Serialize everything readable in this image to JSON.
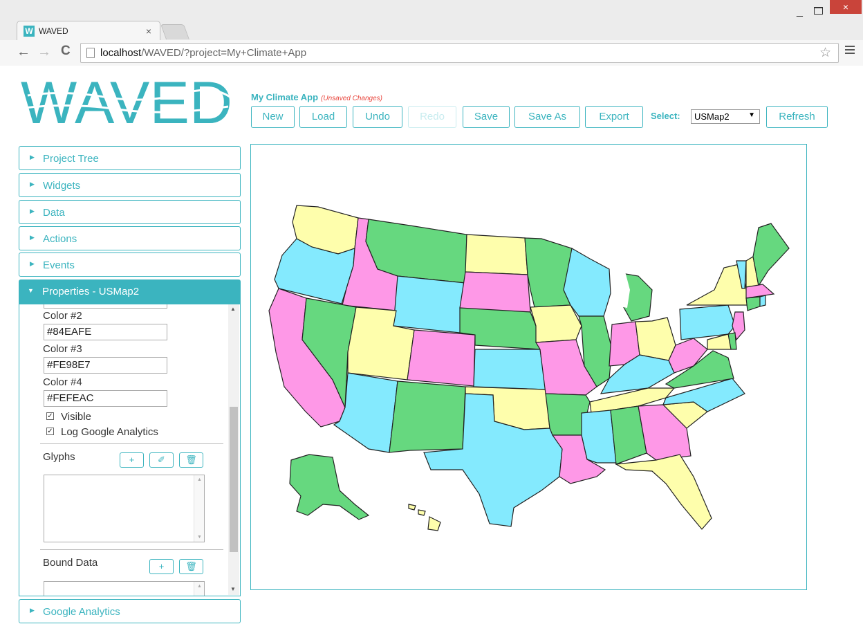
{
  "browser": {
    "tab_title": "WAVED",
    "tab_favicon": "W",
    "tab_close": "×",
    "url_host": "localhost",
    "url_path": "/WAVED/?project=My+Climate+App",
    "icons": [
      "back-icon",
      "forward-icon",
      "reload-icon",
      "page-icon",
      "star-icon",
      "menu-icon"
    ],
    "window_controls": {
      "minimize": "_",
      "close": "×"
    }
  },
  "app": {
    "logo_text": "WAVED",
    "brand_color": "#3bb4bf",
    "project_name": "My Climate App",
    "unsaved_text": "(Unsaved Changes)",
    "toolbar": {
      "new_label": "New",
      "load_label": "Load",
      "undo_label": "Undo",
      "redo_label": "Redo",
      "save_label": "Save",
      "saveas_label": "Save As",
      "export_label": "Export",
      "select_label": "Select:",
      "select_value": "USMap2",
      "refresh_label": "Refresh"
    }
  },
  "sidebar": {
    "sections": [
      {
        "label": "Project Tree"
      },
      {
        "label": "Widgets"
      },
      {
        "label": "Data"
      },
      {
        "label": "Actions"
      },
      {
        "label": "Events"
      }
    ],
    "properties": {
      "title": "Properties - USMap2",
      "color2_label": "Color #2",
      "color2_value": "#84EAFE",
      "color3_label": "Color #3",
      "color3_value": "#FE98E7",
      "color4_label": "Color #4",
      "color4_value": "#FEFEAC",
      "visible_label": "Visible",
      "analytics_label": "Log Google Analytics",
      "glyphs_label": "Glyphs",
      "bound_data_label": "Bound Data"
    },
    "google_analytics": {
      "label": "Google Analytics"
    }
  },
  "map": {
    "colors": {
      "green": "#66d87f",
      "cyan": "#84eafe",
      "pink": "#fe98e7",
      "yellow": "#fefeac"
    },
    "states": [
      {
        "n": "WA",
        "c": "yellow"
      },
      {
        "n": "OR",
        "c": "cyan"
      },
      {
        "n": "CA",
        "c": "pink"
      },
      {
        "n": "ID",
        "c": "pink"
      },
      {
        "n": "NV",
        "c": "green"
      },
      {
        "n": "MT",
        "c": "green"
      },
      {
        "n": "WY",
        "c": "cyan"
      },
      {
        "n": "UT",
        "c": "yellow"
      },
      {
        "n": "AZ",
        "c": "cyan"
      },
      {
        "n": "CO",
        "c": "pink"
      },
      {
        "n": "NM",
        "c": "green"
      },
      {
        "n": "ND",
        "c": "yellow"
      },
      {
        "n": "SD",
        "c": "pink"
      },
      {
        "n": "NE",
        "c": "green"
      },
      {
        "n": "KS",
        "c": "cyan"
      },
      {
        "n": "OK",
        "c": "yellow"
      },
      {
        "n": "TX",
        "c": "cyan"
      },
      {
        "n": "MN",
        "c": "green"
      },
      {
        "n": "IA",
        "c": "yellow"
      },
      {
        "n": "MO",
        "c": "pink"
      },
      {
        "n": "AR",
        "c": "green"
      },
      {
        "n": "LA",
        "c": "pink"
      },
      {
        "n": "WI",
        "c": "cyan"
      },
      {
        "n": "IL",
        "c": "green"
      },
      {
        "n": "MI",
        "c": "green"
      },
      {
        "n": "IN",
        "c": "pink"
      },
      {
        "n": "OH",
        "c": "yellow"
      },
      {
        "n": "KY",
        "c": "cyan"
      },
      {
        "n": "TN",
        "c": "yellow"
      },
      {
        "n": "MS",
        "c": "cyan"
      },
      {
        "n": "AL",
        "c": "green"
      },
      {
        "n": "GA",
        "c": "pink"
      },
      {
        "n": "FL",
        "c": "yellow"
      },
      {
        "n": "SC",
        "c": "yellow"
      },
      {
        "n": "NC",
        "c": "cyan"
      },
      {
        "n": "VA",
        "c": "green"
      },
      {
        "n": "WV",
        "c": "pink"
      },
      {
        "n": "PA",
        "c": "cyan"
      },
      {
        "n": "NY",
        "c": "yellow"
      },
      {
        "n": "VT",
        "c": "cyan"
      },
      {
        "n": "NH",
        "c": "yellow"
      },
      {
        "n": "ME",
        "c": "green"
      },
      {
        "n": "MA",
        "c": "pink"
      },
      {
        "n": "CT",
        "c": "green"
      },
      {
        "n": "RI",
        "c": "cyan"
      },
      {
        "n": "NJ",
        "c": "pink"
      },
      {
        "n": "DE",
        "c": "green"
      },
      {
        "n": "MD",
        "c": "yellow"
      },
      {
        "n": "AK",
        "c": "green"
      },
      {
        "n": "HI",
        "c": "yellow"
      }
    ]
  }
}
